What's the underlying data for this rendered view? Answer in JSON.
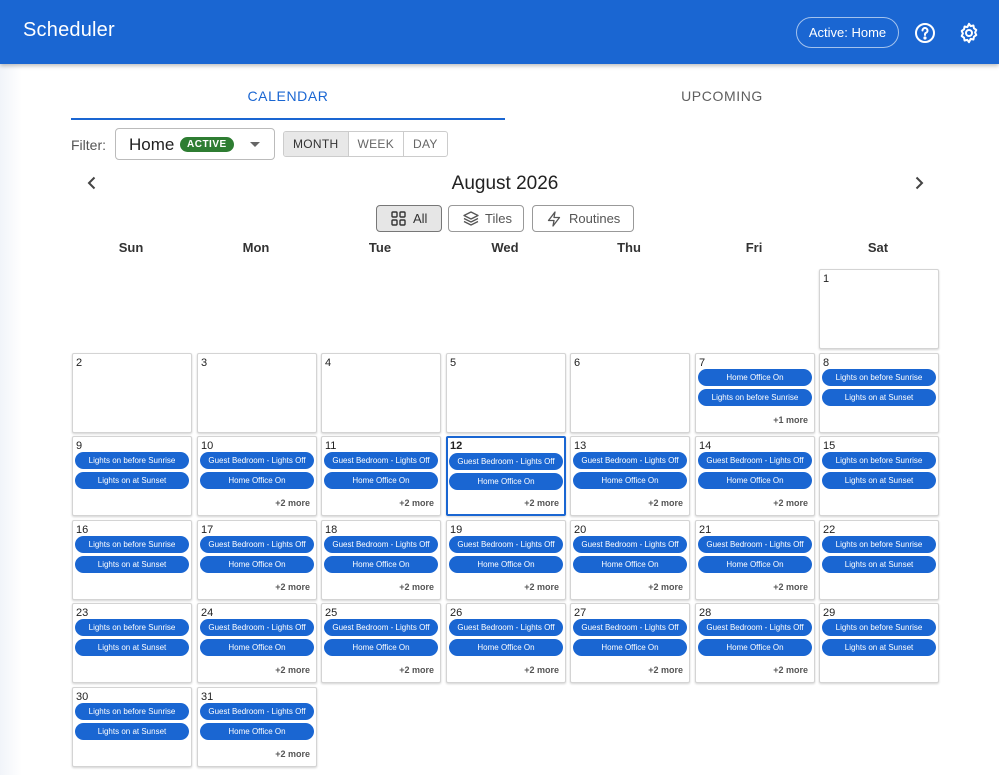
{
  "app": {
    "title": "Scheduler",
    "active_chip": "Active: Home"
  },
  "tabs": [
    {
      "label": "CALENDAR"
    },
    {
      "label": "UPCOMING"
    }
  ],
  "filter": {
    "label": "Filter:",
    "value": "Home",
    "badge": "ACTIVE"
  },
  "view_modes": [
    "MONTH",
    "WEEK",
    "DAY"
  ],
  "calendar": {
    "month_title": "August 2026",
    "filter_toggles": [
      "All",
      "Tiles",
      "Routines"
    ],
    "weekdays": [
      "Sun",
      "Mon",
      "Tue",
      "Wed",
      "Thu",
      "Fri",
      "Sat"
    ],
    "days": [
      {
        "day": "1",
        "events": [],
        "more": ""
      },
      {
        "day": "2",
        "events": [],
        "more": ""
      },
      {
        "day": "3",
        "events": [],
        "more": ""
      },
      {
        "day": "4",
        "events": [],
        "more": ""
      },
      {
        "day": "5",
        "events": [],
        "more": ""
      },
      {
        "day": "6",
        "events": [],
        "more": ""
      },
      {
        "day": "7",
        "events": [
          "Home Office On",
          "Lights on before Sunrise"
        ],
        "more": "+1 more"
      },
      {
        "day": "8",
        "events": [
          "Lights on before Sunrise",
          "Lights on at Sunset"
        ],
        "more": ""
      },
      {
        "day": "9",
        "events": [
          "Lights on before Sunrise",
          "Lights on at Sunset"
        ],
        "more": ""
      },
      {
        "day": "10",
        "events": [
          "Guest Bedroom - Lights Off",
          "Home Office On"
        ],
        "more": "+2 more"
      },
      {
        "day": "11",
        "events": [
          "Guest Bedroom - Lights Off",
          "Home Office On"
        ],
        "more": "+2 more"
      },
      {
        "day": "12",
        "events": [
          "Guest Bedroom - Lights Off",
          "Home Office On"
        ],
        "more": "+2 more"
      },
      {
        "day": "13",
        "events": [
          "Guest Bedroom - Lights Off",
          "Home Office On"
        ],
        "more": "+2 more"
      },
      {
        "day": "14",
        "events": [
          "Guest Bedroom - Lights Off",
          "Home Office On"
        ],
        "more": "+2 more"
      },
      {
        "day": "15",
        "events": [
          "Lights on before Sunrise",
          "Lights on at Sunset"
        ],
        "more": ""
      },
      {
        "day": "16",
        "events": [
          "Lights on before Sunrise",
          "Lights on at Sunset"
        ],
        "more": ""
      },
      {
        "day": "17",
        "events": [
          "Guest Bedroom - Lights Off",
          "Home Office On"
        ],
        "more": "+2 more"
      },
      {
        "day": "18",
        "events": [
          "Guest Bedroom - Lights Off",
          "Home Office On"
        ],
        "more": "+2 more"
      },
      {
        "day": "19",
        "events": [
          "Guest Bedroom - Lights Off",
          "Home Office On"
        ],
        "more": "+2 more"
      },
      {
        "day": "20",
        "events": [
          "Guest Bedroom - Lights Off",
          "Home Office On"
        ],
        "more": "+2 more"
      },
      {
        "day": "21",
        "events": [
          "Guest Bedroom - Lights Off",
          "Home Office On"
        ],
        "more": "+2 more"
      },
      {
        "day": "22",
        "events": [
          "Lights on before Sunrise",
          "Lights on at Sunset"
        ],
        "more": ""
      },
      {
        "day": "23",
        "events": [
          "Lights on before Sunrise",
          "Lights on at Sunset"
        ],
        "more": ""
      },
      {
        "day": "24",
        "events": [
          "Guest Bedroom - Lights Off",
          "Home Office On"
        ],
        "more": "+2 more"
      },
      {
        "day": "25",
        "events": [
          "Guest Bedroom - Lights Off",
          "Home Office On"
        ],
        "more": "+2 more"
      },
      {
        "day": "26",
        "events": [
          "Guest Bedroom - Lights Off",
          "Home Office On"
        ],
        "more": "+2 more"
      },
      {
        "day": "27",
        "events": [
          "Guest Bedroom - Lights Off",
          "Home Office On"
        ],
        "more": "+2 more"
      },
      {
        "day": "28",
        "events": [
          "Guest Bedroom - Lights Off",
          "Home Office On"
        ],
        "more": "+2 more"
      },
      {
        "day": "29",
        "events": [
          "Lights on before Sunrise",
          "Lights on at Sunset"
        ],
        "more": ""
      },
      {
        "day": "30",
        "events": [
          "Lights on before Sunrise",
          "Lights on at Sunset"
        ],
        "more": ""
      },
      {
        "day": "31",
        "events": [
          "Guest Bedroom - Lights Off",
          "Home Office On"
        ],
        "more": "+2 more"
      }
    ]
  },
  "colors": {
    "primary": "#1a66d2",
    "active_badge": "#2e7d32"
  },
  "icons": {
    "help": "help-circle-icon",
    "settings": "gear-icon",
    "prev": "chevron-left-icon",
    "next": "chevron-right-icon",
    "all": "grid-icon",
    "tiles": "layers-icon",
    "routines": "lightning-icon"
  }
}
